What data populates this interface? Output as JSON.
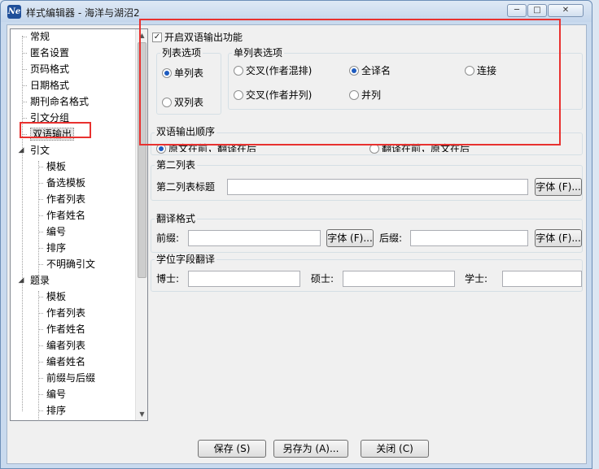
{
  "window": {
    "title": "样式编辑器 - 海洋与湖沼2",
    "icon": "app-logo-icon",
    "min_label": "─",
    "max_label": "□",
    "close_label": "✕"
  },
  "tree": {
    "items": [
      {
        "label": "常规"
      },
      {
        "label": "匿名设置"
      },
      {
        "label": "页码格式"
      },
      {
        "label": "日期格式"
      },
      {
        "label": "期刊命名格式"
      },
      {
        "label": "引文分组"
      },
      {
        "label": "双语输出"
      },
      {
        "label": "引文"
      },
      {
        "label": "模板"
      },
      {
        "label": "备选模板"
      },
      {
        "label": "作者列表"
      },
      {
        "label": "作者姓名"
      },
      {
        "label": "编号"
      },
      {
        "label": "排序"
      },
      {
        "label": "不明确引文"
      },
      {
        "label": "题录"
      },
      {
        "label": "模板"
      },
      {
        "label": "作者列表"
      },
      {
        "label": "作者姓名"
      },
      {
        "label": "编者列表"
      },
      {
        "label": "编者姓名"
      },
      {
        "label": "前缀与后缀"
      },
      {
        "label": "编号"
      },
      {
        "label": "排序"
      }
    ],
    "selected": "双语输出",
    "expanded_marker": "◢"
  },
  "bilingual": {
    "enable_label": "开启双语输出功能",
    "enable_checked": true,
    "list_options": {
      "title": "列表选项",
      "single": "单列表",
      "double": "双列表",
      "selected": "单列表"
    },
    "single_list_options": {
      "title": "单列表选项",
      "cross_mixed": "交叉(作者混排)",
      "full_translate": "全译名",
      "connect": "连接",
      "cross_parallel": "交叉(作者并列)",
      "parallel": "并列",
      "selected": "全译名"
    },
    "order": {
      "title": "双语输出顺序",
      "original_first": "原文在前，翻译在后",
      "translation_first": "翻译在前，原文在后",
      "selected": "原文在前，翻译在后"
    }
  },
  "second_list": {
    "title": "第二列表",
    "title_label": "第二列表标题",
    "title_value": "",
    "font_button": "字体 (F)..."
  },
  "translation_format": {
    "title": "翻译格式",
    "prefix_label": "前缀:",
    "prefix_value": "",
    "prefix_font_button": "字体 (F)...",
    "suffix_label": "后缀:",
    "suffix_value": "",
    "suffix_font_button": "字体 (F)..."
  },
  "degree_translation": {
    "title": "学位字段翻译",
    "doctor_label": "博士:",
    "doctor_value": "",
    "master_label": "硕士:",
    "master_value": "",
    "bachelor_label": "学士:",
    "bachelor_value": ""
  },
  "footer": {
    "save": "保存 (S)",
    "save_as": "另存为 (A)...",
    "close": "关闭 (C)"
  },
  "colors": {
    "highlight": "#e8312f",
    "radio_dot": "#1d5bbf"
  }
}
